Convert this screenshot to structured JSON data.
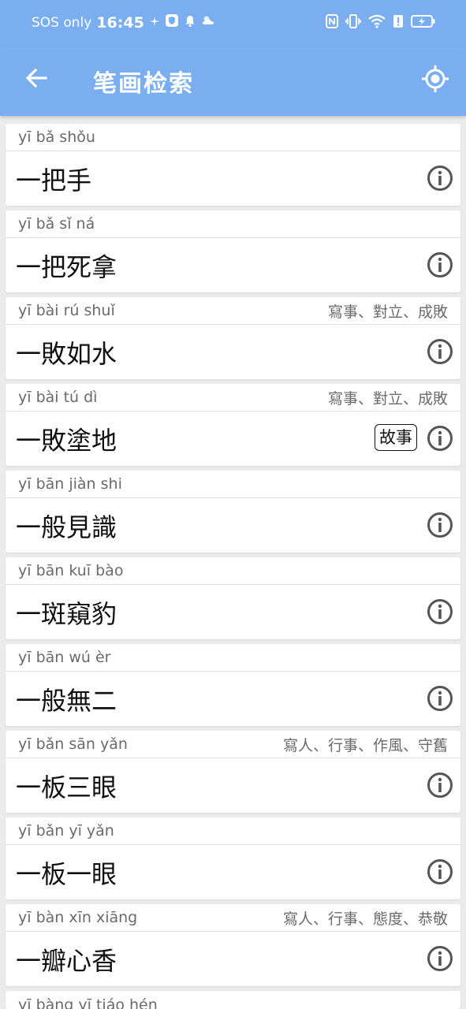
{
  "status_bar": {
    "carrier": "SOS only",
    "time": "16:45"
  },
  "app_bar": {
    "title": "笔画检索"
  },
  "colors": {
    "accent": "#7aaef0",
    "icon_gray": "#555555"
  },
  "items": [
    {
      "pinyin": "yī bǎ shǒu",
      "idiom": "一把手",
      "tags": "",
      "badge": ""
    },
    {
      "pinyin": "yī bǎ sǐ ná",
      "idiom": "一把死拿",
      "tags": "",
      "badge": ""
    },
    {
      "pinyin": "yī bài rú shuǐ",
      "idiom": "一敗如水",
      "tags": "寫事、對立、成敗",
      "badge": ""
    },
    {
      "pinyin": "yī bài tú dì",
      "idiom": "一敗塗地",
      "tags": "寫事、對立、成敗",
      "badge": "故事"
    },
    {
      "pinyin": "yī bān jiàn shi",
      "idiom": "一般見識",
      "tags": "",
      "badge": ""
    },
    {
      "pinyin": "yī bān kuī bào",
      "idiom": "一斑窺豹",
      "tags": "",
      "badge": ""
    },
    {
      "pinyin": "yī bān wú èr",
      "idiom": "一般無二",
      "tags": "",
      "badge": ""
    },
    {
      "pinyin": "yī bǎn sān yǎn",
      "idiom": "一板三眼",
      "tags": "寫人、行事、作風、守舊",
      "badge": ""
    },
    {
      "pinyin": "yī bǎn yī yǎn",
      "idiom": "一板一眼",
      "tags": "",
      "badge": ""
    },
    {
      "pinyin": "yī bàn xīn xiāng",
      "idiom": "一瓣心香",
      "tags": "寫人、行事、態度、恭敬",
      "badge": ""
    },
    {
      "pinyin": "yī bàng yī tiáo hén",
      "idiom": "",
      "tags": "",
      "badge": ""
    }
  ]
}
